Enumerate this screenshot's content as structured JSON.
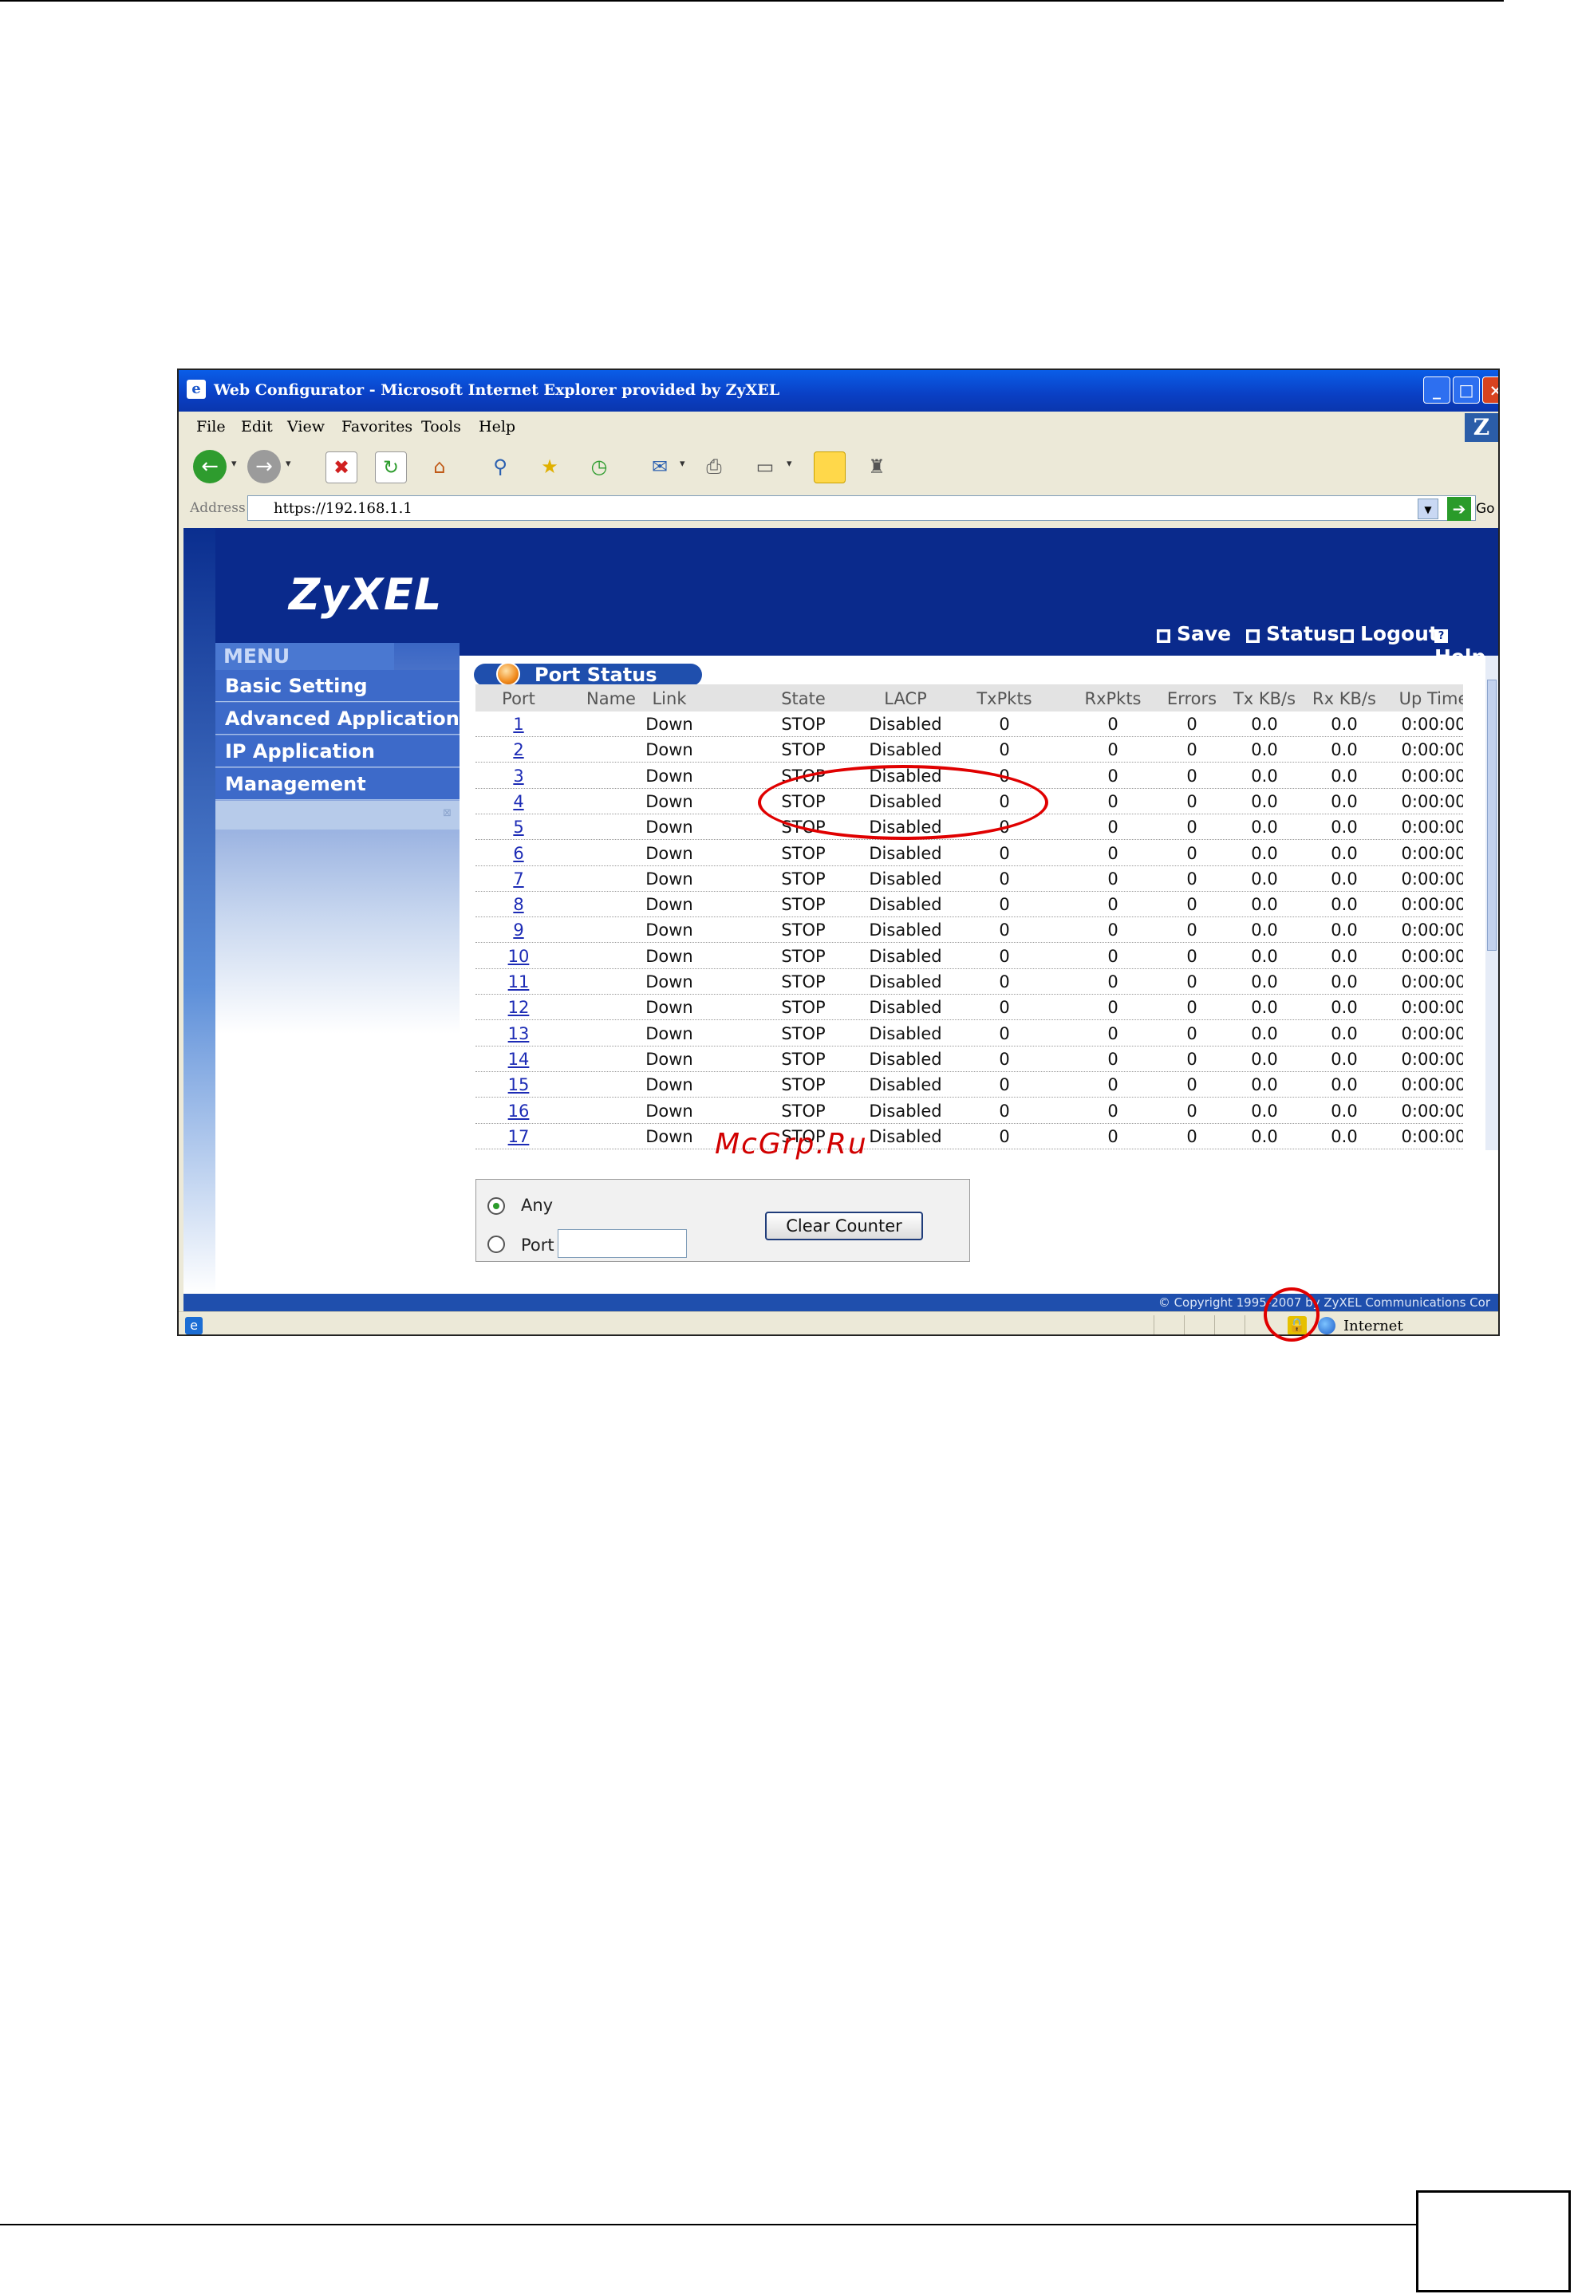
{
  "window": {
    "title": "Web Configurator - Microsoft Internet Explorer provided by ZyXEL",
    "menus": [
      "File",
      "Edit",
      "View",
      "Favorites",
      "Tools",
      "Help"
    ],
    "address_label": "Address",
    "url": "https://192.168.1.1",
    "go_label": "Go",
    "status_zone": "Internet"
  },
  "app": {
    "logo": "ZyXEL",
    "header_links": [
      "Save",
      "Status",
      "Logout",
      "Help"
    ],
    "menu_tab": "MENU",
    "sidebar": [
      "Basic Setting",
      "Advanced Application",
      "IP Application",
      "Management"
    ],
    "panel_title": "Port Status",
    "footer": "© Copyright 1995-2007 by ZyXEL Communications Cor"
  },
  "table": {
    "columns": [
      "Port",
      "Name",
      "Link",
      "State",
      "LACP",
      "TxPkts",
      "RxPkts",
      "Errors",
      "Tx KB/s",
      "Rx KB/s",
      "Up Time"
    ],
    "rows": [
      [
        "1",
        "",
        "Down",
        "STOP",
        "Disabled",
        "0",
        "0",
        "0",
        "0.0",
        "0.0",
        "0:00:00"
      ],
      [
        "2",
        "",
        "Down",
        "STOP",
        "Disabled",
        "0",
        "0",
        "0",
        "0.0",
        "0.0",
        "0:00:00"
      ],
      [
        "3",
        "",
        "Down",
        "STOP",
        "Disabled",
        "0",
        "0",
        "0",
        "0.0",
        "0.0",
        "0:00:00"
      ],
      [
        "4",
        "",
        "Down",
        "STOP",
        "Disabled",
        "0",
        "0",
        "0",
        "0.0",
        "0.0",
        "0:00:00"
      ],
      [
        "5",
        "",
        "Down",
        "STOP",
        "Disabled",
        "0",
        "0",
        "0",
        "0.0",
        "0.0",
        "0:00:00"
      ],
      [
        "6",
        "",
        "Down",
        "STOP",
        "Disabled",
        "0",
        "0",
        "0",
        "0.0",
        "0.0",
        "0:00:00"
      ],
      [
        "7",
        "",
        "Down",
        "STOP",
        "Disabled",
        "0",
        "0",
        "0",
        "0.0",
        "0.0",
        "0:00:00"
      ],
      [
        "8",
        "",
        "Down",
        "STOP",
        "Disabled",
        "0",
        "0",
        "0",
        "0.0",
        "0.0",
        "0:00:00"
      ],
      [
        "9",
        "",
        "Down",
        "STOP",
        "Disabled",
        "0",
        "0",
        "0",
        "0.0",
        "0.0",
        "0:00:00"
      ],
      [
        "10",
        "",
        "Down",
        "STOP",
        "Disabled",
        "0",
        "0",
        "0",
        "0.0",
        "0.0",
        "0:00:00"
      ],
      [
        "11",
        "",
        "Down",
        "STOP",
        "Disabled",
        "0",
        "0",
        "0",
        "0.0",
        "0.0",
        "0:00:00"
      ],
      [
        "12",
        "",
        "Down",
        "STOP",
        "Disabled",
        "0",
        "0",
        "0",
        "0.0",
        "0.0",
        "0:00:00"
      ],
      [
        "13",
        "",
        "Down",
        "STOP",
        "Disabled",
        "0",
        "0",
        "0",
        "0.0",
        "0.0",
        "0:00:00"
      ],
      [
        "14",
        "",
        "Down",
        "STOP",
        "Disabled",
        "0",
        "0",
        "0",
        "0.0",
        "0.0",
        "0:00:00"
      ],
      [
        "15",
        "",
        "Down",
        "STOP",
        "Disabled",
        "0",
        "0",
        "0",
        "0.0",
        "0.0",
        "0:00:00"
      ],
      [
        "16",
        "",
        "Down",
        "STOP",
        "Disabled",
        "0",
        "0",
        "0",
        "0.0",
        "0.0",
        "0:00:00"
      ],
      [
        "17",
        "",
        "Down",
        "STOP",
        "Disabled",
        "0",
        "0",
        "0",
        "0.0",
        "0.0",
        "0:00:00"
      ]
    ]
  },
  "counter": {
    "any_label": "Any",
    "port_label": "Port",
    "port_value": "",
    "selected": "Any",
    "clear_button": "Clear Counter"
  },
  "watermark": "McGrp.Ru",
  "colors": {
    "header_blue": "#0a2a8c",
    "annotation_red": "#e00000",
    "link_blue": "#1c2bb5"
  },
  "icons": [
    "ie-icon",
    "minimize-icon",
    "maximize-icon",
    "close-icon",
    "back-icon",
    "forward-icon",
    "stop-icon",
    "refresh-icon",
    "home-icon",
    "search-icon",
    "favorites-icon",
    "history-icon",
    "mail-icon",
    "print-icon",
    "edit-icon",
    "note-icon",
    "messenger-icon",
    "go-icon",
    "lock-icon",
    "globe-icon"
  ]
}
